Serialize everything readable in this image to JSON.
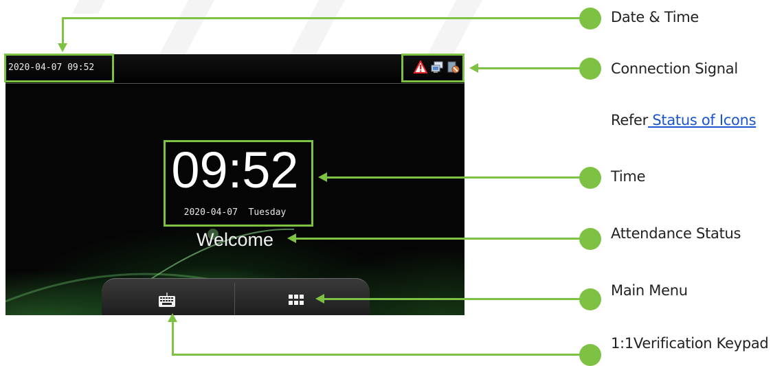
{
  "screen": {
    "status_datetime": "2020-04-07 09:52",
    "status_icons": [
      "warning-icon",
      "network-icon",
      "server-icon"
    ],
    "clock_time": "09:52",
    "clock_date": "2020-04-07  Tuesday",
    "attendance_status": "Welcome",
    "softkeys": [
      "keyboard-icon",
      "main-menu-icon"
    ]
  },
  "callouts": {
    "date_time": "Date & Time",
    "connection_signal": "Connection Signal",
    "refer_prefix": "Refer",
    "refer_link": " Status of Icons",
    "time": "Time",
    "attendance_status": "Attendance Status",
    "main_menu": "Main Menu",
    "verification_keypad": "1:1Verification Keypad"
  },
  "colors": {
    "callout_green": "#7ec244",
    "link_blue": "#1a55d0",
    "screen_bg": "#050505"
  }
}
